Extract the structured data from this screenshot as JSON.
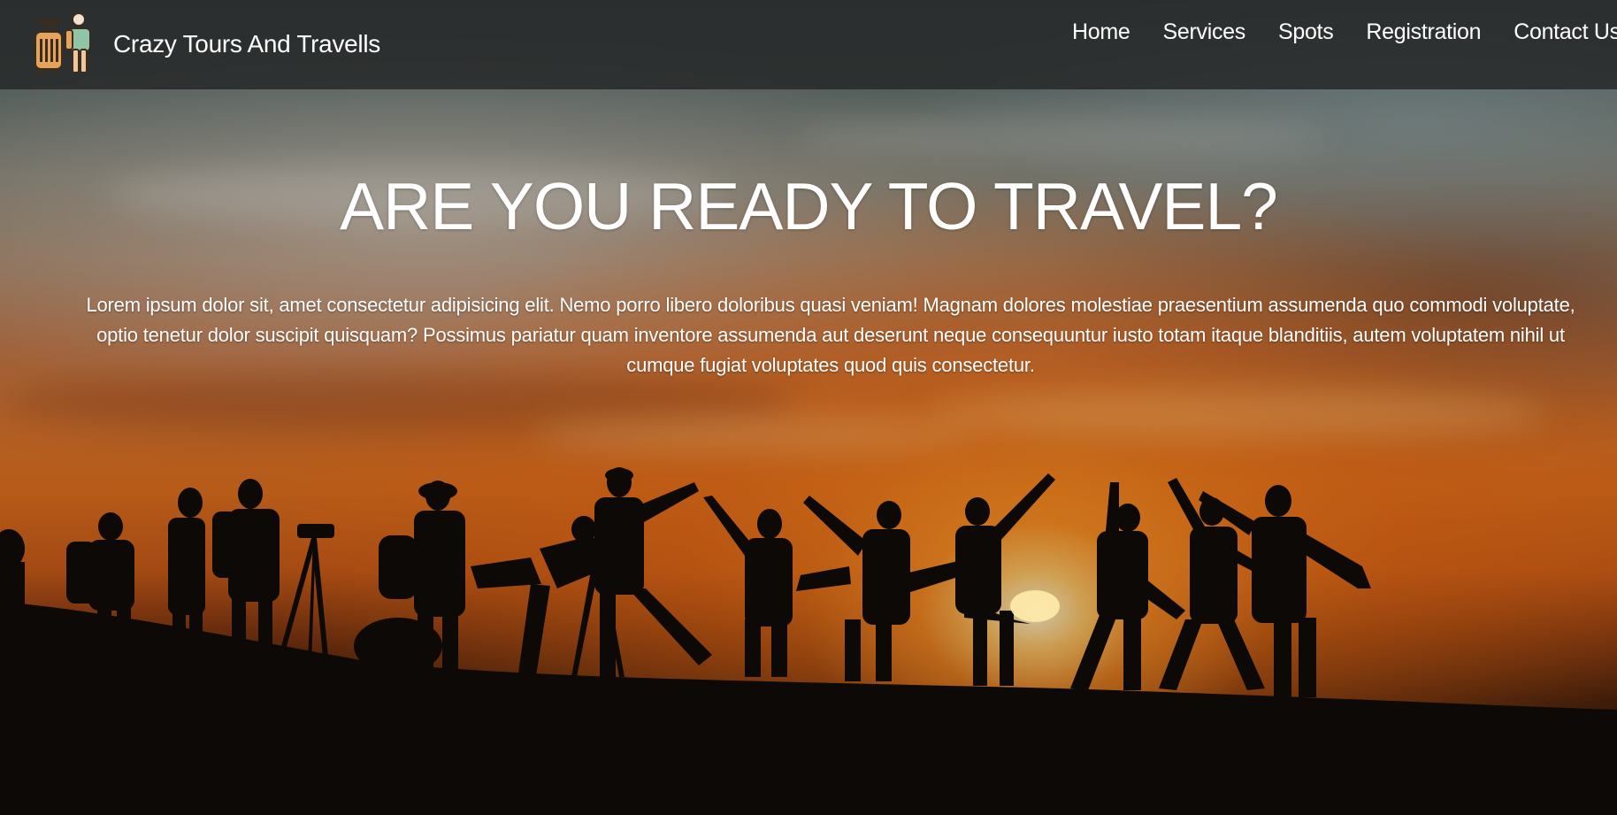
{
  "brand": {
    "name": "Crazy Tours And Travells",
    "logo_icon": "traveler-with-luggage-icon"
  },
  "nav": {
    "items": [
      {
        "label": "Home"
      },
      {
        "label": "Services"
      },
      {
        "label": "Spots"
      },
      {
        "label": "Registration"
      },
      {
        "label": "Contact Us"
      }
    ]
  },
  "hero": {
    "title": "ARE YOU READY TO TRAVEL?",
    "description": "Lorem ipsum dolor sit, amet consectetur adipisicing elit. Nemo porro libero doloribus quasi veniam! Magnam dolores molestiae praesentium assumenda quo commodi voluptate, optio tenetur dolor suscipit quisquam? Possimus pariatur quam inventore assumenda aut deserunt neque consequuntur iusto totam itaque blanditiis, autem voluptatem nihil ut cumque fugiat voluptates quod quis consectetur.",
    "background_image": "group of travelers silhouetted against a sunset sky"
  },
  "colors": {
    "navbar_bg": "#282a2a",
    "text": "#ffffff",
    "sunset_orange": "#e0701f"
  }
}
